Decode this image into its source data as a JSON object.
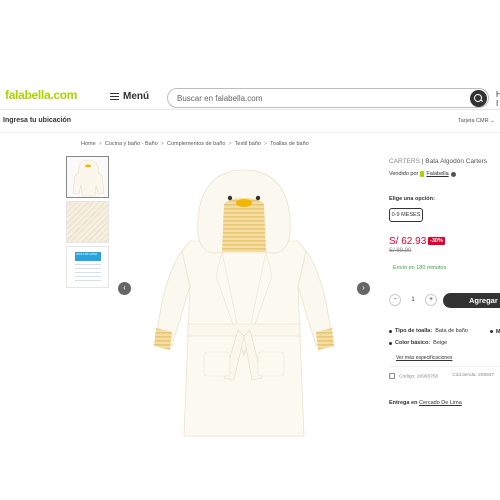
{
  "header": {
    "logo": "falabella",
    "logo_tld": ".com",
    "menu_label": "Menú",
    "search_placeholder": "Buscar en falabella.com",
    "user_initial_1": "H",
    "user_initial_2": "I"
  },
  "subbar": {
    "location": "Ingresa tu ubicación",
    "cart_tag": "Tarjeta CMR ⌄"
  },
  "breadcrumb": [
    "Home",
    "Cocina y baño - Baño",
    "Complementos de baño",
    "Textil baño",
    "Toallas de baño"
  ],
  "gallery": {
    "thumb_label_text": "SAVE FOR LATER"
  },
  "product": {
    "brand": "CARTERS",
    "name": "Bata Algodón Carters",
    "sold_by_prefix": "Vendido por",
    "seller": "Falabella",
    "option_title": "Elige una opción:",
    "selected_option": "0-9 MESES",
    "price": "S/ 62.93",
    "discount": "-30%",
    "old_price": "S/ 89.90",
    "delivery_text": "Envío en 180 minutos",
    "quantity": "1",
    "minus": "-",
    "plus": "+",
    "add_label": "Agregar a",
    "specs": [
      {
        "label": "Tipo de toalla:",
        "value": "Bata de baño"
      },
      {
        "label": "Color básico:",
        "value": "Beige"
      }
    ],
    "specs_extra_marker": "M",
    "more_specs": "Ver más especificaciones",
    "code_1": "Código: 20993758",
    "code_2": "Cód.tienda: 209937",
    "delivery_prefix": "Entrega en",
    "delivery_location": "Cercado De Lima"
  },
  "colors": {
    "brand_green": "#aad500",
    "price_red": "#e4002b",
    "delivery_green": "#3ca343",
    "dark": "#333333"
  }
}
